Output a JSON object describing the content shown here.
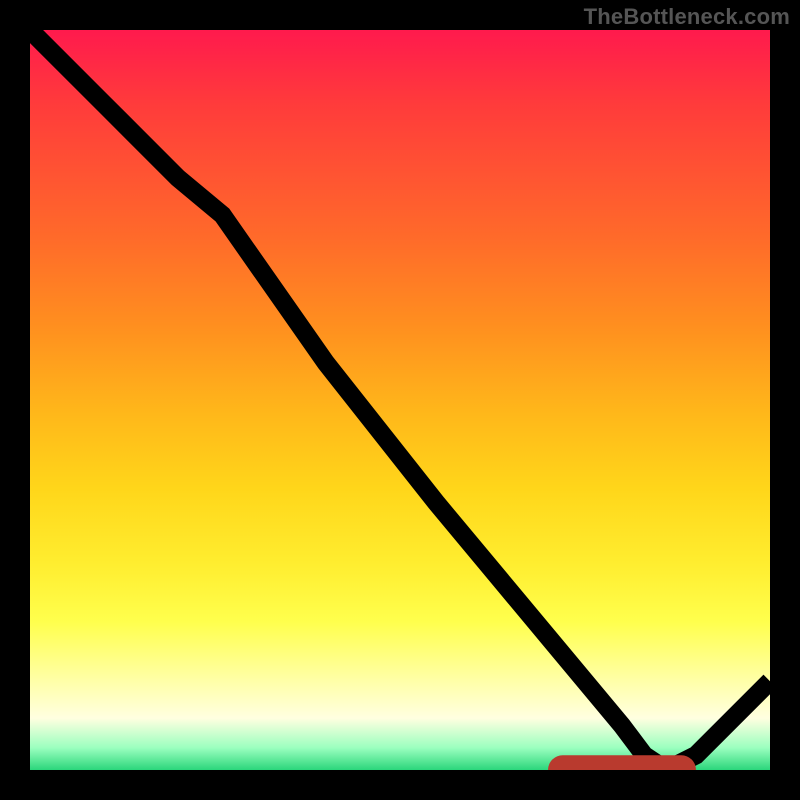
{
  "attribution": "TheBottleneck.com",
  "chart_data": {
    "type": "line",
    "title": "",
    "xlabel": "",
    "ylabel": "",
    "xlim": [
      0,
      100
    ],
    "ylim": [
      0,
      100
    ],
    "grid": false,
    "legend": false,
    "series": [
      {
        "name": "curve",
        "x": [
          0,
          10,
          20,
          26,
          40,
          55,
          70,
          80,
          83,
          86,
          90,
          100
        ],
        "y": [
          100,
          90,
          80,
          75,
          55,
          36,
          18,
          6,
          2,
          0,
          2,
          12
        ]
      }
    ],
    "annotations": [
      {
        "name": "baseline-segment",
        "x_start": 72,
        "x_end": 88,
        "y": 0
      }
    ],
    "background_gradient": {
      "orientation": "vertical",
      "stops": [
        {
          "pos": 0.0,
          "color": "#ff1a4d"
        },
        {
          "pos": 0.4,
          "color": "#ff8f1f"
        },
        {
          "pos": 0.72,
          "color": "#ffed2f"
        },
        {
          "pos": 0.93,
          "color": "#ffffe0"
        },
        {
          "pos": 1.0,
          "color": "#2bd67b"
        }
      ]
    }
  }
}
